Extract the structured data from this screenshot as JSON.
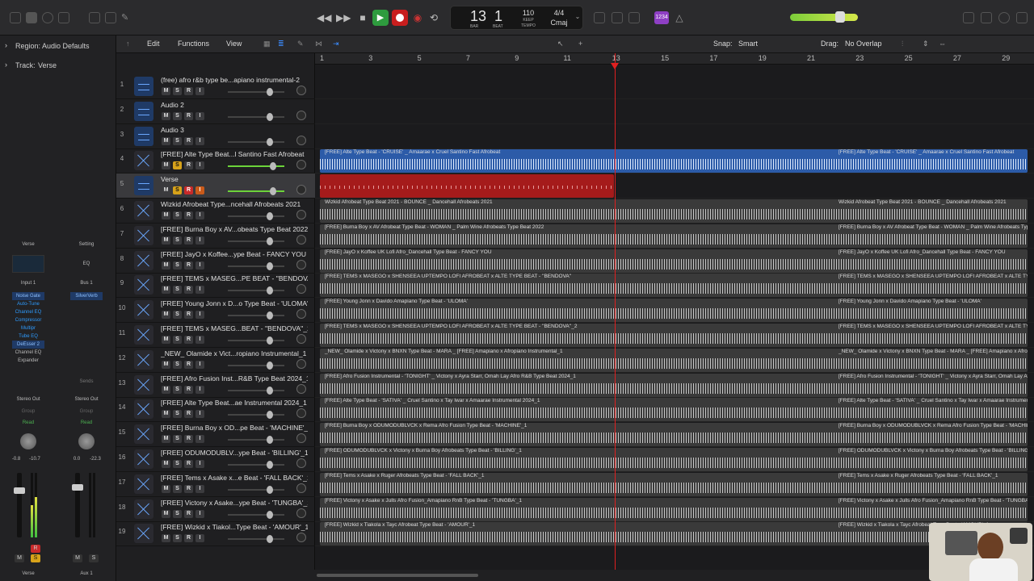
{
  "transport": {
    "bar": "13",
    "beat": "1",
    "bar_label": "BAR",
    "beat_label": "BEAT",
    "tempo": "110",
    "tempo_label": "KEEP",
    "tempo_sub": "TEMPO",
    "signature": "4/4",
    "key": "Cmaj",
    "counter": "1234"
  },
  "inspector": {
    "region_label": "Region: Audio Defaults",
    "track_label": "Track:",
    "track_name": "Verse",
    "strip1": {
      "name": "Verse",
      "input": "Input 1",
      "plugins": [
        "Noise Gate",
        "Auto-Tune",
        "Channel EQ",
        "Compressor",
        "Multipr",
        "Tube EQ",
        "DeEsser 2",
        "Channel EQ",
        "Expander"
      ],
      "output": "Stereo Out",
      "group": "Group",
      "mode": "Read",
      "vol_a": "-0.8",
      "vol_b": "-10.7",
      "label": "Verse"
    },
    "strip2": {
      "name": "Setting",
      "eq": "EQ",
      "send": "Bus 1",
      "plugins": [
        "SilverVerb"
      ],
      "sends_label": "Sends",
      "output": "Stereo Out",
      "group": "Group",
      "mode": "Read",
      "vol_a": "0.0",
      "vol_b": "-22.3",
      "label": "Aux 1"
    },
    "m": "M",
    "s": "S",
    "r": "R"
  },
  "menubar": {
    "edit": "Edit",
    "functions": "Functions",
    "view": "View",
    "snap_label": "Snap:",
    "snap_value": "Smart",
    "drag_label": "Drag:",
    "drag_value": "No Overlap"
  },
  "ruler": [
    "1",
    "3",
    "5",
    "7",
    "9",
    "11",
    "13",
    "15",
    "17",
    "19",
    "21",
    "23",
    "25",
    "27",
    "29"
  ],
  "buttons": {
    "m": "M",
    "s": "S",
    "r": "R",
    "i": "I"
  },
  "tracks": [
    {
      "num": "1",
      "name": "(free) afro r&b type be...apiano instrumental-2",
      "type": "audio",
      "region": ""
    },
    {
      "num": "2",
      "name": "Audio 2",
      "type": "audio",
      "region": ""
    },
    {
      "num": "3",
      "name": "Audio 3",
      "type": "audio",
      "region": ""
    },
    {
      "num": "4",
      "name": "[FREE] Alte Type Beat...l Santino Fast Afrobeat",
      "type": "x",
      "region": "[FREE] Alte Type Beat - 'CRUISE' _ Amaarae x Cruel Santino Fast Afrobeat",
      "color": "blue"
    },
    {
      "num": "5",
      "name": "Verse",
      "type": "audio",
      "region": "",
      "color": "red"
    },
    {
      "num": "6",
      "name": "Wizkid Afrobeat Type...ncehall Afrobeats 2021",
      "type": "x",
      "region": "Wizkid Afrobeat Type Beat 2021 - BOUNCE _ Dancehall Afrobeats 2021"
    },
    {
      "num": "7",
      "name": "[FREE] Burna Boy x AV...obeats Type Beat 2022",
      "type": "x",
      "region": "[FREE] Burna Boy x AV Afrobeat Type Beat - WOMAN _ Palm Wine Afrobeats Type Beat 2022"
    },
    {
      "num": "8",
      "name": "[FREE] JayO x Koffee...ype Beat - FANCY YOU",
      "type": "x",
      "region": "[FREE] JayO x Koffee UK Lofi Afro_Dancehall Type Beat - FANCY YOU"
    },
    {
      "num": "9",
      "name": "[FREE] TEMS x MASEG...PE BEAT - ''BENDOVA''",
      "type": "x",
      "region": "[FREE] TEMS x MASEGO x SHENSEEA UPTEMPO LOFI AFROBEAT x ALTE TYPE BEAT - ''BENDOVA''"
    },
    {
      "num": "10",
      "name": "[FREE] Young Jonn x D...o Type Beat - 'ULOMA'",
      "type": "x",
      "region": "[FREE] Young Jonn x Davido Amapiano Type Beat - 'ULOMA'"
    },
    {
      "num": "11",
      "name": "[FREE] TEMS x MASEG...BEAT - ''BENDOVA''_2",
      "type": "x",
      "region": "[FREE] TEMS x MASEGO x SHENSEEA UPTEMPO LOFI AFROBEAT x ALTE TYPE BEAT - ''BENDOVA''_2"
    },
    {
      "num": "12",
      "name": "_NEW_ Olamide x Vict...ropiano Instrumental_1",
      "type": "x",
      "region": "_NEW_ Olamide x Victony x BNXN Type Beat - MARA _ [FREE] Amapiano x Afropiano Instrumental_1"
    },
    {
      "num": "13",
      "name": "[FREE] Afro Fusion Inst...R&B Type Beat 2024_1",
      "type": "x",
      "region": "[FREE] Afro Fusion Instrumental - 'TONIGHT' _ Victony x Ayra Starr, Omah Lay Afro R&B Type Beat 2024_1"
    },
    {
      "num": "14",
      "name": "[FREE] Alte Type Beat...ae Instrumental 2024_1",
      "type": "x",
      "region": "[FREE] Alte Type Beat - 'SATIVA' _ Cruel Santino x Tay Iwar x Amaarae Instrumental 2024_1"
    },
    {
      "num": "15",
      "name": "[FREE] Burna Boy x OD...pe Beat - 'MACHINE'_1",
      "type": "x",
      "region": "[FREE] Burna Boy x ODUMODUBLVCK x Rema Afro Fusion Type Beat - 'MACHINE'_1"
    },
    {
      "num": "16",
      "name": "[FREE] ODUMODUBLV...ype Beat - 'BILLING'_1",
      "type": "x",
      "region": "[FREE] ODUMODUBLVCK x Victony x Burna Boy Afrobeats Type Beat - 'BILLING'_1"
    },
    {
      "num": "17",
      "name": "[FREE] Tems x Asake x...e Beat - 'FALL BACK'_1",
      "type": "x",
      "region": "[FREE] Tems x Asake x Ruger Afrobeats Type Beat - 'FALL BACK'_1"
    },
    {
      "num": "18",
      "name": "[FREE] Victony x Asake...ype Beat - 'TUNGBA'_1",
      "type": "x",
      "region": "[FREE] Victony x Asake x Julls Afro Fusion_Amapiano RnB Type Beat - 'TUNGBA'_1"
    },
    {
      "num": "19",
      "name": "[FREE] Wizkid x Tiakol...Type Beat - 'AMOUR'_1",
      "type": "x",
      "region": "[FREE] Wizkid x Tiakola x Tayc Afrobeat Type Beat - 'AMOUR'_1"
    }
  ]
}
